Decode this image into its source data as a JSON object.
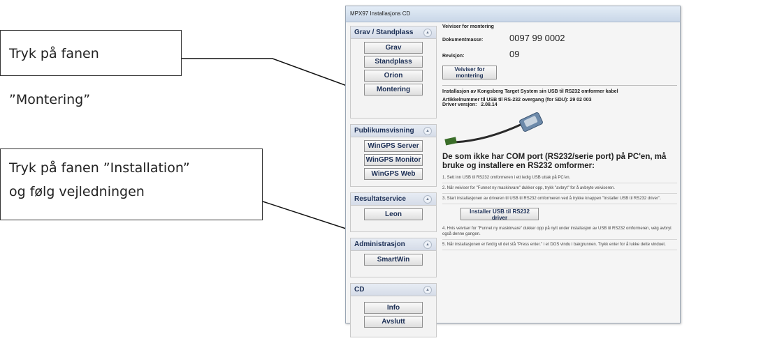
{
  "callouts": {
    "c1": "Tryk på fanen ”Montering”",
    "c2_line1": "Tryk på fanen ”Installation”",
    "c2_line2": "og følg vejledningen"
  },
  "window": {
    "title": "MPX97 Installasjons CD"
  },
  "sidebar": {
    "groups": [
      {
        "title": "Grav / Standplass",
        "buttons": [
          "Grav",
          "Standplass",
          "Orion",
          "Montering"
        ]
      },
      {
        "title": "Publikumsvisning",
        "buttons": [
          "WinGPS Server",
          "WinGPS Monitor",
          "WinGPS Web"
        ]
      },
      {
        "title": "Resultatservice",
        "buttons": [
          "Leon"
        ]
      },
      {
        "title": "Administrasjon",
        "buttons": [
          "SmartWin"
        ]
      },
      {
        "title": "CD",
        "buttons": [
          "Info",
          "Avslutt"
        ]
      }
    ]
  },
  "main": {
    "wizard_title": "Veiviser for montering",
    "doc_label": "Dokumentmasse:",
    "doc_value": "0097 99 0002",
    "rev_label": "Revisjon:",
    "rev_value": "09",
    "wizard_button": "Veiviser for montering",
    "install_title": "Installasjon av Kongsberg Target System sin USB til RS232 omformer kabel",
    "article_line": "Artikkelnummer til USB til RS-232 overgang (for SDU): 29 02 003",
    "driver_label": "Driver versjon:",
    "driver_value": "2.08.14",
    "big_text": "De som ikke har COM port (RS232/serie port) på PC'en, må bruke og installere en RS232 omformer:",
    "steps": [
      "1. Sett inn USB til RS232 omformeren i ett ledig USB uttak på PC'en.",
      "2. Når veiviser for \"Funnet ny maskinvare\" dukker opp, trykk \"avbryt\" for å avbryte veiviseren.",
      "3. Start installasjonen av driveren til USB til RS232 omformeren ved å trykke knappen \"Installer USB til RS232 driver\"."
    ],
    "install_button": "Installer USB til RS232 driver",
    "steps_after": [
      "4. Hvis veiviser for \"Funnet ny maskinvare\" dukker opp på nytt under installasjon av USB til RS232 omformeren, velg avbryt også denne gangen.",
      "5. Når installasjonen er ferdig vil det stå \"Press enter.\" i et DOS vindu i bakgrunnen. Trykk enter for å lukke dette vinduet."
    ]
  }
}
